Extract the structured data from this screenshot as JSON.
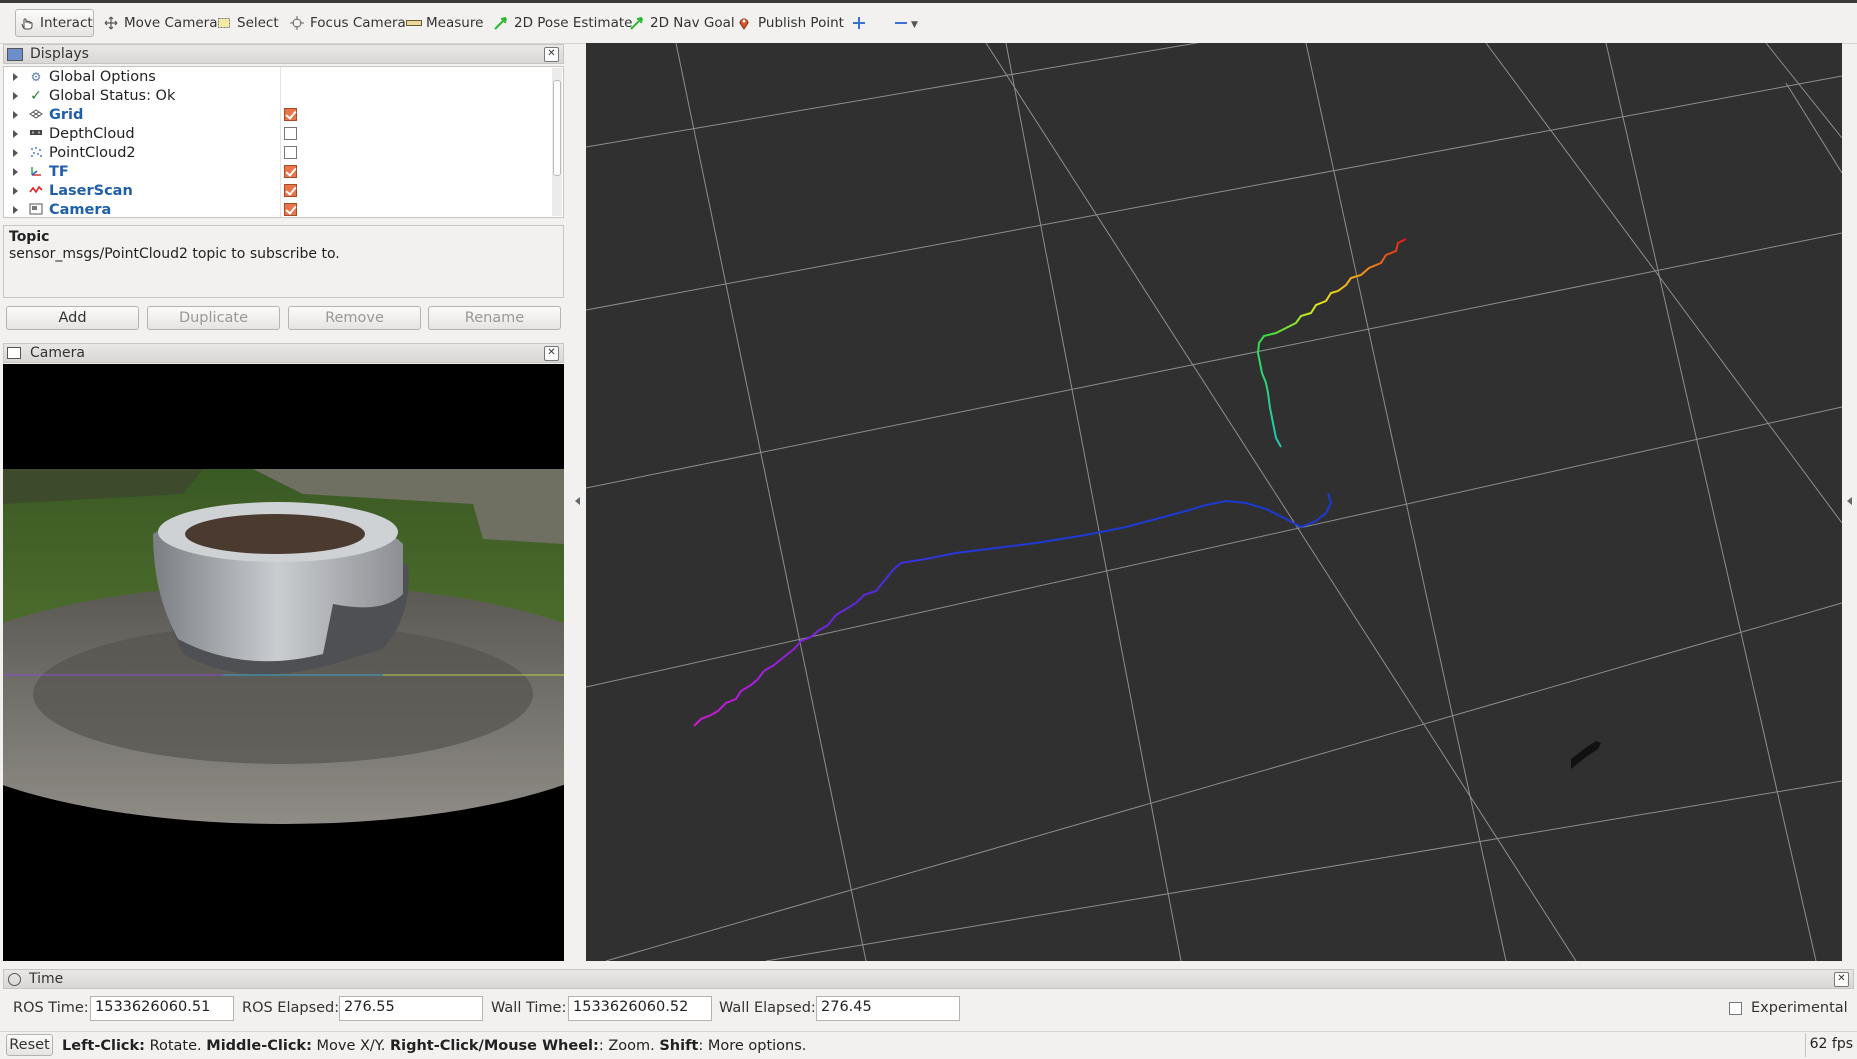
{
  "toolbar": {
    "tools": [
      {
        "label": "Interact",
        "icon": "hand-cursor-icon"
      },
      {
        "label": "Move Camera",
        "icon": "move-arrows-icon"
      },
      {
        "label": "Select",
        "icon": "select-box-icon"
      },
      {
        "label": "Focus Camera",
        "icon": "focus-target-icon"
      },
      {
        "label": "Measure",
        "icon": "ruler-icon"
      },
      {
        "label": "2D Pose Estimate",
        "icon": "green-arrow-icon"
      },
      {
        "label": "2D Nav Goal",
        "icon": "green-arrow-icon"
      },
      {
        "label": "Publish Point",
        "icon": "map-pin-icon"
      }
    ]
  },
  "displays": {
    "title": "Displays",
    "items": [
      {
        "label": "Global Options",
        "icon": "gear-icon",
        "checked": null,
        "highlight": false
      },
      {
        "label": "Global Status: Ok",
        "icon": "checkmark-icon",
        "checked": null,
        "highlight": false
      },
      {
        "label": "Grid",
        "icon": "grid-icon",
        "checked": true,
        "highlight": true
      },
      {
        "label": "DepthCloud",
        "icon": "depthcloud-icon",
        "checked": false,
        "highlight": false
      },
      {
        "label": "PointCloud2",
        "icon": "pointcloud-icon",
        "checked": false,
        "highlight": false
      },
      {
        "label": "TF",
        "icon": "tf-axes-icon",
        "checked": true,
        "highlight": true
      },
      {
        "label": "LaserScan",
        "icon": "laserscan-icon",
        "checked": true,
        "highlight": true
      },
      {
        "label": "Camera",
        "icon": "camera-icon",
        "checked": true,
        "highlight": true
      }
    ],
    "description_title": "Topic",
    "description_text": "sensor_msgs/PointCloud2 topic to subscribe to.",
    "buttons": {
      "add": "Add",
      "duplicate": "Duplicate",
      "remove": "Remove",
      "rename": "Rename"
    }
  },
  "camera_panel": {
    "title": "Camera"
  },
  "time_panel": {
    "title": "Time",
    "ros_time_label": "ROS Time:",
    "ros_time": "1533626060.51",
    "ros_elapsed_label": "ROS Elapsed:",
    "ros_elapsed": "276.55",
    "wall_time_label": "Wall Time:",
    "wall_time": "1533626060.52",
    "wall_elapsed_label": "Wall Elapsed:",
    "wall_elapsed": "276.45",
    "experimental_label": "Experimental"
  },
  "status": {
    "reset": "Reset",
    "left_click_key": "Left-Click:",
    "left_click_val": "Rotate.",
    "middle_click_key": "Middle-Click:",
    "middle_click_val": "Move X/Y.",
    "right_click_key": "Right-Click/Mouse Wheel:",
    "right_click_val": ": Zoom.",
    "shift_key": "Shift",
    "shift_val": ": More options.",
    "fps": "62 fps"
  },
  "colors": {
    "viewport_bg": "#303030",
    "grid_line": "#9a9a9a",
    "check_on": "#e8764a",
    "highlight_text": "#1f5fa8"
  }
}
